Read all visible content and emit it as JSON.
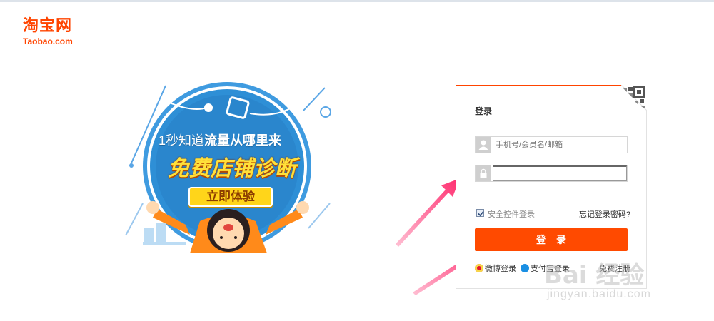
{
  "header": {
    "logo_cn": "淘宝网",
    "logo_en": "Taobao.com"
  },
  "promo": {
    "line1_thin": "1秒知道",
    "line1_bold": "流量从哪里来",
    "line2": "免费店铺诊断",
    "button_label": "立即体验"
  },
  "login": {
    "title": "登录",
    "username_placeholder": "手机号/会员名/邮箱",
    "password_value": "",
    "security_control_label": "安全控件登录",
    "security_control_checked": true,
    "forgot_password": "忘记登录密码?",
    "submit_label": "登录",
    "alt_weibo": "微博登录",
    "alt_alipay": "支付宝登录",
    "alt_register": "免费注册"
  },
  "watermark": {
    "brand": "Bai 经验",
    "url": "jingyan.baidu.com"
  },
  "colors": {
    "brand_orange": "#ff4400",
    "button_orange": "#ff4a00",
    "arrow_pink": "#ff2d6f",
    "promo_blue": "#2e8fd6"
  },
  "icons": [
    "user-icon",
    "lock-icon",
    "qr-code-icon",
    "weibo-icon",
    "alipay-icon",
    "checkbox-icon",
    "arrow-icon"
  ]
}
